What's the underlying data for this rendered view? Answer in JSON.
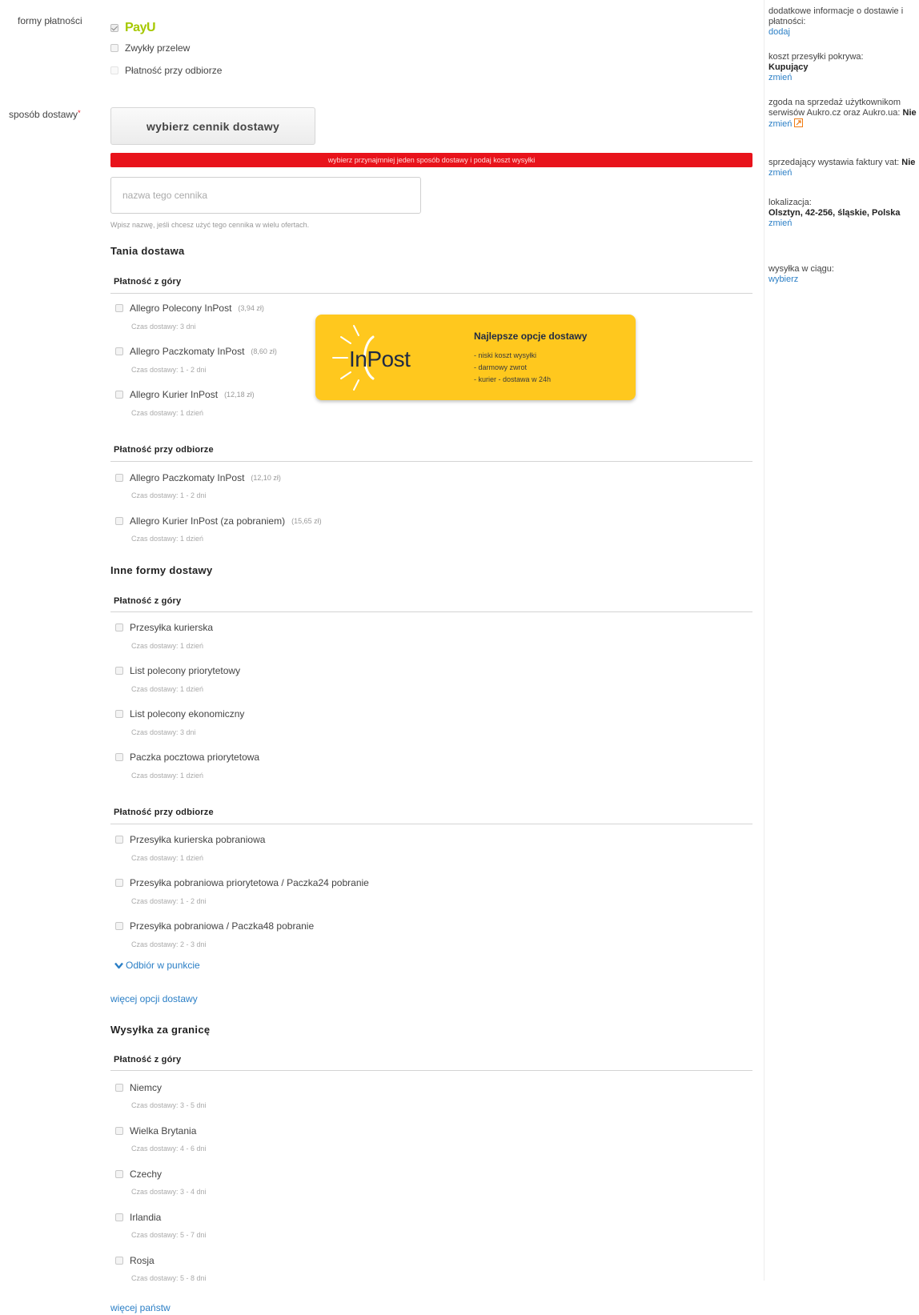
{
  "payment": {
    "label": "formy płatności",
    "payu_logo": "PayU",
    "options": [
      "Zwykły przelew",
      "Płatność przy odbiorze"
    ]
  },
  "delivery": {
    "label": "sposób dostawy",
    "required_mark": "*",
    "choose_button": "wybierz cennik dostawy",
    "error": "wybierz przynajmniej jeden sposób dostawy i podaj koszt wysyłki",
    "name_placeholder": "nazwa tego cennika",
    "name_hint": "Wpisz nazwę, jeśli chcesz użyć tego cennika w wielu ofertach."
  },
  "cheap": {
    "title": "Tania dostawa",
    "prepaid_title": "Płatność z góry",
    "prepaid": [
      {
        "name": "Allegro Polecony InPost",
        "price": "(3,94 zł)",
        "time": "Czas dostawy: 3 dni"
      },
      {
        "name": "Allegro Paczkomaty InPost",
        "price": "(8,60 zł)",
        "time": "Czas dostawy: 1 - 2 dni"
      },
      {
        "name": "Allegro Kurier InPost",
        "price": "(12,18 zł)",
        "time": "Czas dostawy: 1 dzień"
      }
    ],
    "cod_title": "Płatność przy odbiorze",
    "cod": [
      {
        "name": "Allegro Paczkomaty InPost",
        "price": "(12,10 zł)",
        "time": "Czas dostawy: 1 - 2 dni"
      },
      {
        "name": "Allegro Kurier InPost (za pobraniem)",
        "price": "(15,65 zł)",
        "time": "Czas dostawy: 1 dzień"
      }
    ]
  },
  "banner": {
    "logo": "InPost",
    "title": "Najlepsze opcje dostawy",
    "lines": [
      "- niski koszt wysyłki",
      "- darmowy zwrot",
      "- kurier - dostawa w 24h"
    ]
  },
  "other": {
    "title": "Inne formy dostawy",
    "prepaid_title": "Płatność z góry",
    "prepaid": [
      {
        "name": "Przesyłka kurierska",
        "time": "Czas dostawy: 1 dzień"
      },
      {
        "name": "List polecony priorytetowy",
        "time": "Czas dostawy: 1 dzień"
      },
      {
        "name": "List polecony ekonomiczny",
        "time": "Czas dostawy: 3 dni"
      },
      {
        "name": "Paczka pocztowa priorytetowa",
        "time": "Czas dostawy: 1 dzień"
      }
    ],
    "cod_title": "Płatność przy odbiorze",
    "cod": [
      {
        "name": "Przesyłka kurierska pobraniowa",
        "time": "Czas dostawy: 1 dzień"
      },
      {
        "name": "Przesyłka pobraniowa priorytetowa / Paczka24 pobranie",
        "time": "Czas dostawy: 1 - 2 dni"
      },
      {
        "name": "Przesyłka pobraniowa / Paczka48 pobranie",
        "time": "Czas dostawy: 2 - 3 dni"
      }
    ],
    "pickup_link": "Odbiór w punkcie",
    "more_link": "więcej opcji dostawy"
  },
  "abroad": {
    "title": "Wysyłka za granicę",
    "prepaid_title": "Płatność z góry",
    "countries": [
      {
        "name": "Niemcy",
        "time": "Czas dostawy: 3 - 5 dni"
      },
      {
        "name": "Wielka Brytania",
        "time": "Czas dostawy: 4 - 6 dni"
      },
      {
        "name": "Czechy",
        "time": "Czas dostawy: 3 - 4 dni"
      },
      {
        "name": "Irlandia",
        "time": "Czas dostawy: 5 - 7 dni"
      },
      {
        "name": "Rosja",
        "time": "Czas dostawy: 5 - 8 dni"
      }
    ],
    "more_link": "więcej państw"
  },
  "sidebar": {
    "info_text": "dodatkowe informacje o dostawie i płatności:",
    "info_link": "dodaj",
    "cost_text": "koszt przesyłki pokrywa:",
    "cost_value": "Kupujący",
    "cost_link": "zmień",
    "consent_text": "zgoda na sprzedaż użytkownikom serwisów Aukro.cz oraz Aukro.ua:",
    "consent_value": "Nie",
    "consent_link": "zmień",
    "vat_text": "sprzedający wystawia faktury vat:",
    "vat_value": "Nie",
    "vat_link": "zmień",
    "location_text": "lokalizacja:",
    "location_value": "Olsztyn, 42-256, śląskie, Polska",
    "location_link": "zmień",
    "ship_text": "wysyłka w ciągu:",
    "ship_link": "wybierz"
  }
}
